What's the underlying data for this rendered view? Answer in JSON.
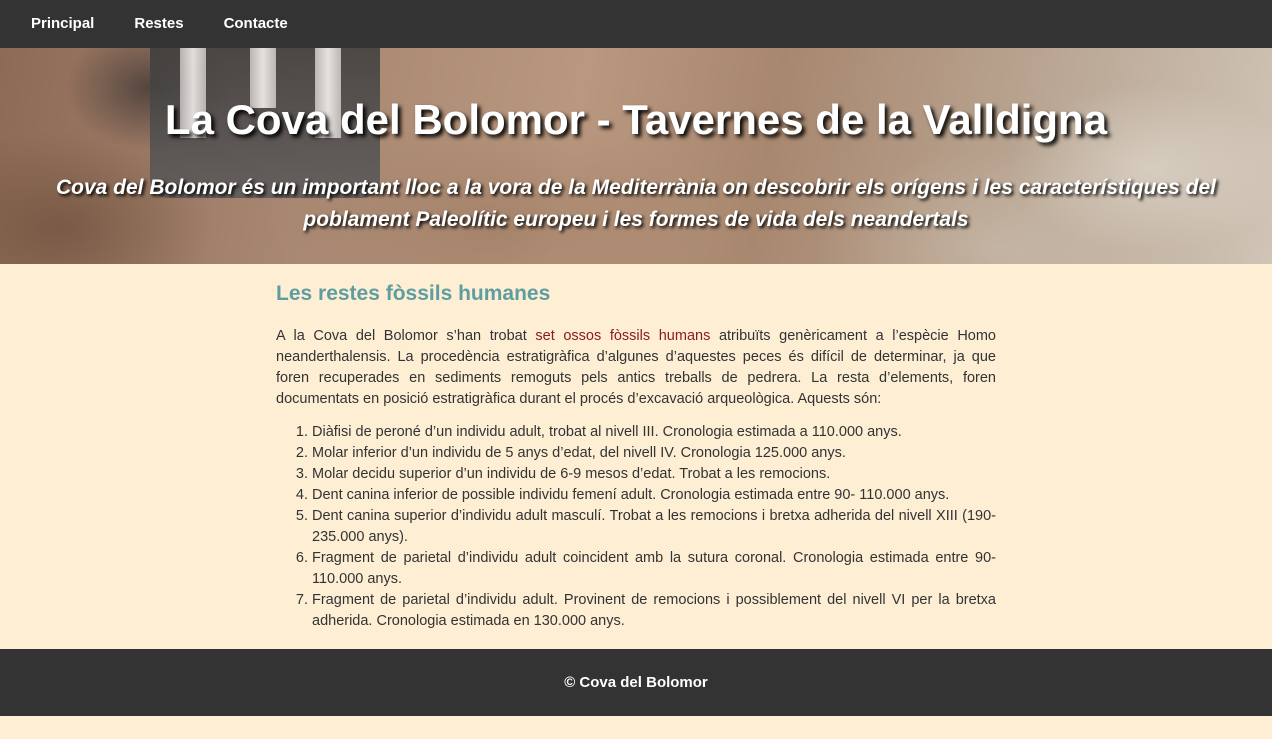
{
  "nav": {
    "items": [
      {
        "label": "Principal"
      },
      {
        "label": "Restes"
      },
      {
        "label": "Contacte"
      }
    ]
  },
  "hero": {
    "title": "La Cova del Bolomor - Tavernes de la Valldigna",
    "subtitle": "Cova del Bolomor és un important lloc a la vora de la Mediterrània on descobrir els orígens i les característiques del poblament Paleolític europeu i les formes de vida dels neandertals"
  },
  "main": {
    "heading": "Les restes fòssils humanes",
    "intro_before": "A la Cova del Bolomor s’han trobat ",
    "intro_link": "set ossos fòssils humans",
    "intro_after": " atribuïts genèricament a l’espècie Homo neanderthalensis. La procedència estratigràfica d’algunes d’aquestes peces és difícil de determinar, ja que foren recuperades en sediments remoguts pels antics treballs de pedrera. La resta d’elements, foren documentats en posició estratigràfica durant el procés d’excavació arqueològica. Aquests són:",
    "items": [
      "Diàfisi de peroné d’un individu adult, trobat al nivell III. Cronologia estimada a 110.000 anys.",
      "Molar inferior d’un individu de 5 anys d’edat, del nivell IV. Cronologia 125.000 anys.",
      "Molar decidu superior d’un individu de 6-9 mesos d’edat. Trobat a les remocions.",
      "Dent canina inferior de possible individu femení adult. Cronologia estimada entre 90- 110.000 anys.",
      "Dent canina superior d’individu adult masculí. Trobat a les remocions i bretxa adherida del nivell XIII (190-235.000 anys).",
      "Fragment de parietal d’individu adult coincident amb la sutura coronal. Cronologia estimada entre 90-110.000 anys.",
      "Fragment de parietal d’individu adult. Provinent de remocions i possiblement del nivell VI per la bretxa adherida. Cronologia estimada en 130.000 anys."
    ]
  },
  "footer": {
    "text": "© Cova del Bolomor"
  }
}
